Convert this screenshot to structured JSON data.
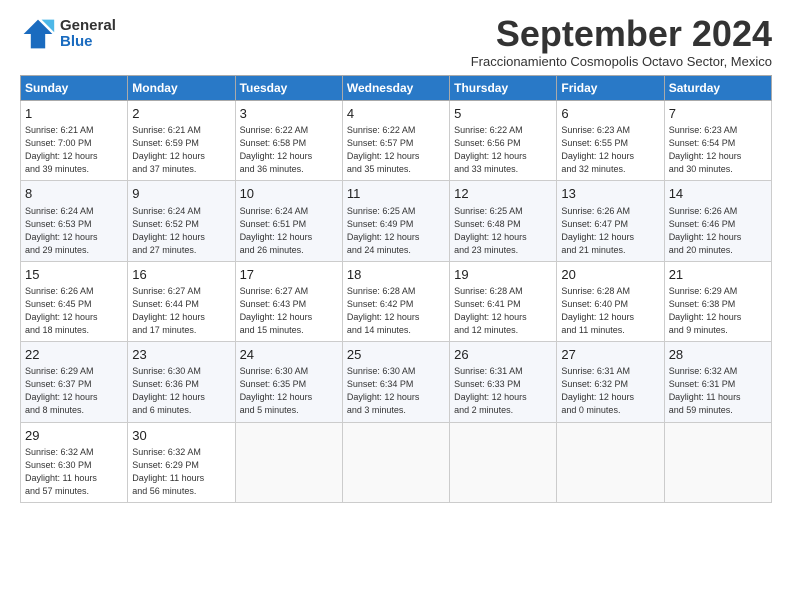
{
  "logo": {
    "general": "General",
    "blue": "Blue"
  },
  "title": "September 2024",
  "subtitle": "Fraccionamiento Cosmopolis Octavo Sector, Mexico",
  "days_header": [
    "Sunday",
    "Monday",
    "Tuesday",
    "Wednesday",
    "Thursday",
    "Friday",
    "Saturday"
  ],
  "weeks": [
    [
      {
        "day": "1",
        "info": "Sunrise: 6:21 AM\nSunset: 7:00 PM\nDaylight: 12 hours\nand 39 minutes."
      },
      {
        "day": "2",
        "info": "Sunrise: 6:21 AM\nSunset: 6:59 PM\nDaylight: 12 hours\nand 37 minutes."
      },
      {
        "day": "3",
        "info": "Sunrise: 6:22 AM\nSunset: 6:58 PM\nDaylight: 12 hours\nand 36 minutes."
      },
      {
        "day": "4",
        "info": "Sunrise: 6:22 AM\nSunset: 6:57 PM\nDaylight: 12 hours\nand 35 minutes."
      },
      {
        "day": "5",
        "info": "Sunrise: 6:22 AM\nSunset: 6:56 PM\nDaylight: 12 hours\nand 33 minutes."
      },
      {
        "day": "6",
        "info": "Sunrise: 6:23 AM\nSunset: 6:55 PM\nDaylight: 12 hours\nand 32 minutes."
      },
      {
        "day": "7",
        "info": "Sunrise: 6:23 AM\nSunset: 6:54 PM\nDaylight: 12 hours\nand 30 minutes."
      }
    ],
    [
      {
        "day": "8",
        "info": "Sunrise: 6:24 AM\nSunset: 6:53 PM\nDaylight: 12 hours\nand 29 minutes."
      },
      {
        "day": "9",
        "info": "Sunrise: 6:24 AM\nSunset: 6:52 PM\nDaylight: 12 hours\nand 27 minutes."
      },
      {
        "day": "10",
        "info": "Sunrise: 6:24 AM\nSunset: 6:51 PM\nDaylight: 12 hours\nand 26 minutes."
      },
      {
        "day": "11",
        "info": "Sunrise: 6:25 AM\nSunset: 6:49 PM\nDaylight: 12 hours\nand 24 minutes."
      },
      {
        "day": "12",
        "info": "Sunrise: 6:25 AM\nSunset: 6:48 PM\nDaylight: 12 hours\nand 23 minutes."
      },
      {
        "day": "13",
        "info": "Sunrise: 6:26 AM\nSunset: 6:47 PM\nDaylight: 12 hours\nand 21 minutes."
      },
      {
        "day": "14",
        "info": "Sunrise: 6:26 AM\nSunset: 6:46 PM\nDaylight: 12 hours\nand 20 minutes."
      }
    ],
    [
      {
        "day": "15",
        "info": "Sunrise: 6:26 AM\nSunset: 6:45 PM\nDaylight: 12 hours\nand 18 minutes."
      },
      {
        "day": "16",
        "info": "Sunrise: 6:27 AM\nSunset: 6:44 PM\nDaylight: 12 hours\nand 17 minutes."
      },
      {
        "day": "17",
        "info": "Sunrise: 6:27 AM\nSunset: 6:43 PM\nDaylight: 12 hours\nand 15 minutes."
      },
      {
        "day": "18",
        "info": "Sunrise: 6:28 AM\nSunset: 6:42 PM\nDaylight: 12 hours\nand 14 minutes."
      },
      {
        "day": "19",
        "info": "Sunrise: 6:28 AM\nSunset: 6:41 PM\nDaylight: 12 hours\nand 12 minutes."
      },
      {
        "day": "20",
        "info": "Sunrise: 6:28 AM\nSunset: 6:40 PM\nDaylight: 12 hours\nand 11 minutes."
      },
      {
        "day": "21",
        "info": "Sunrise: 6:29 AM\nSunset: 6:38 PM\nDaylight: 12 hours\nand 9 minutes."
      }
    ],
    [
      {
        "day": "22",
        "info": "Sunrise: 6:29 AM\nSunset: 6:37 PM\nDaylight: 12 hours\nand 8 minutes."
      },
      {
        "day": "23",
        "info": "Sunrise: 6:30 AM\nSunset: 6:36 PM\nDaylight: 12 hours\nand 6 minutes."
      },
      {
        "day": "24",
        "info": "Sunrise: 6:30 AM\nSunset: 6:35 PM\nDaylight: 12 hours\nand 5 minutes."
      },
      {
        "day": "25",
        "info": "Sunrise: 6:30 AM\nSunset: 6:34 PM\nDaylight: 12 hours\nand 3 minutes."
      },
      {
        "day": "26",
        "info": "Sunrise: 6:31 AM\nSunset: 6:33 PM\nDaylight: 12 hours\nand 2 minutes."
      },
      {
        "day": "27",
        "info": "Sunrise: 6:31 AM\nSunset: 6:32 PM\nDaylight: 12 hours\nand 0 minutes."
      },
      {
        "day": "28",
        "info": "Sunrise: 6:32 AM\nSunset: 6:31 PM\nDaylight: 11 hours\nand 59 minutes."
      }
    ],
    [
      {
        "day": "29",
        "info": "Sunrise: 6:32 AM\nSunset: 6:30 PM\nDaylight: 11 hours\nand 57 minutes."
      },
      {
        "day": "30",
        "info": "Sunrise: 6:32 AM\nSunset: 6:29 PM\nDaylight: 11 hours\nand 56 minutes."
      },
      {
        "day": "",
        "info": ""
      },
      {
        "day": "",
        "info": ""
      },
      {
        "day": "",
        "info": ""
      },
      {
        "day": "",
        "info": ""
      },
      {
        "day": "",
        "info": ""
      }
    ]
  ]
}
